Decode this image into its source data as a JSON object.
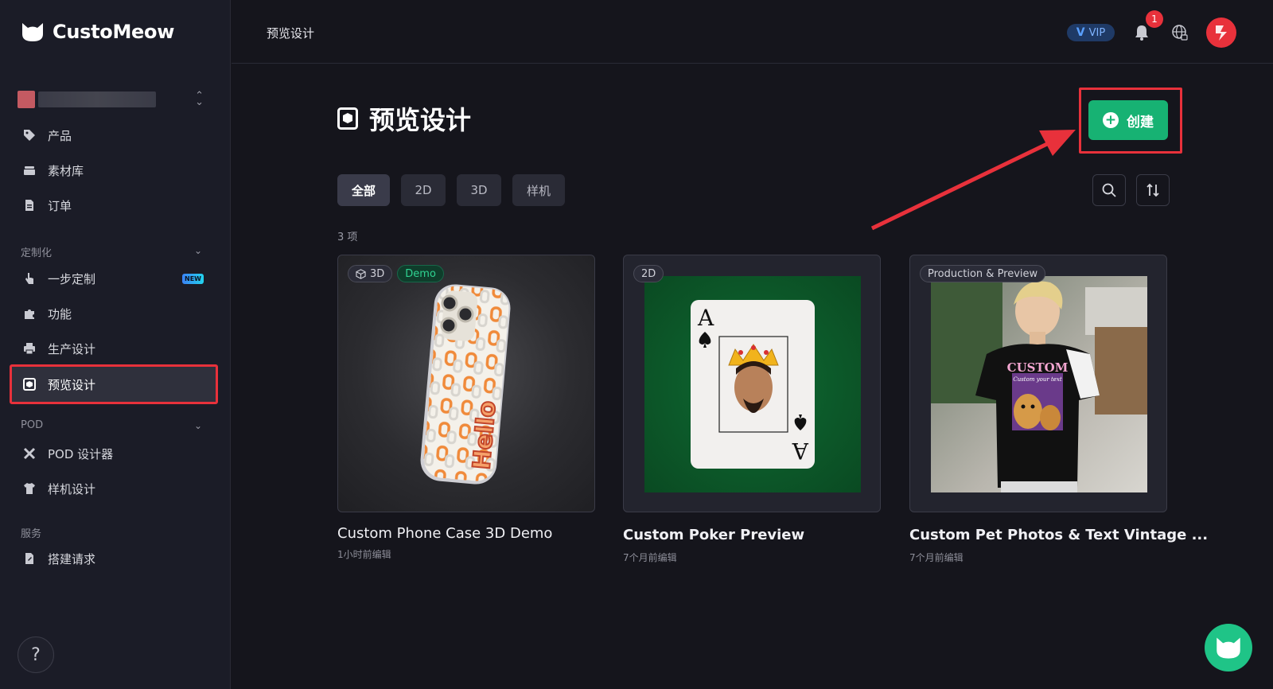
{
  "app": {
    "name": "CustoMeow"
  },
  "topbar": {
    "title": "预览设计",
    "vip_label": "VIP",
    "notification_count": "1"
  },
  "sidebar": {
    "main_items": [
      {
        "label": "产品",
        "icon": "tag-icon"
      },
      {
        "label": "素材库",
        "icon": "library-icon"
      },
      {
        "label": "订单",
        "icon": "document-icon"
      }
    ],
    "sections": [
      {
        "label": "定制化",
        "items": [
          {
            "label": "一步定制",
            "icon": "pointer-icon",
            "badge": "NEW"
          },
          {
            "label": "功能",
            "icon": "puzzle-icon"
          },
          {
            "label": "生产设计",
            "icon": "printer-icon"
          },
          {
            "label": "预览设计",
            "icon": "preview-icon",
            "active": true
          }
        ]
      },
      {
        "label": "POD",
        "items": [
          {
            "label": "POD 设计器",
            "icon": "tools-icon"
          },
          {
            "label": "样机设计",
            "icon": "shirt-icon"
          }
        ]
      },
      {
        "label": "服务",
        "items": [
          {
            "label": "搭建请求",
            "icon": "request-icon"
          }
        ]
      }
    ],
    "help_label": "?"
  },
  "main": {
    "title": "预览设计",
    "create_label": "创建",
    "filters": [
      "全部",
      "2D",
      "3D",
      "样机"
    ],
    "active_filter": "全部",
    "count_label": "3 项",
    "cards": [
      {
        "tags": [
          "3D",
          "Demo"
        ],
        "title": "Custom Phone Case 3D Demo",
        "edited": "1小时前编辑",
        "phone_text": "Hello"
      },
      {
        "tags": [
          "2D"
        ],
        "title": "Custom Poker Preview",
        "edited": "7个月前编辑",
        "card_rank": "A"
      },
      {
        "tags": [
          "Production & Preview"
        ],
        "title": "Custom Pet Photos & Text Vintage ...",
        "edited": "7个月前编辑",
        "shirt_text": "CUSTOM",
        "shirt_subtext": "Custom your text"
      }
    ]
  },
  "colors": {
    "accent_green": "#17b273",
    "highlight_red": "#e8313b",
    "sidebar_bg": "#1b1c27",
    "page_bg": "#15151c"
  }
}
